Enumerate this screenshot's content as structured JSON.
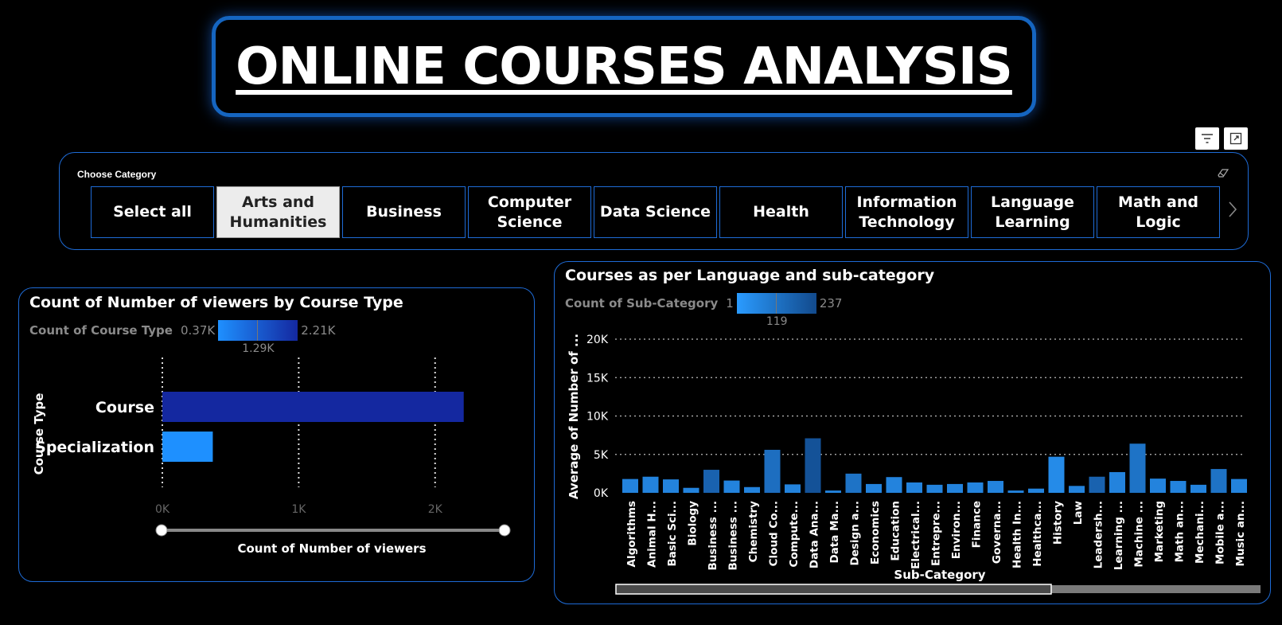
{
  "page": {
    "title": "ONLINE COURSES ANALYSIS"
  },
  "slicer": {
    "label": "Choose Category",
    "items": [
      {
        "label": "Select all",
        "selected": false
      },
      {
        "label": "Arts and Humanities",
        "selected": true
      },
      {
        "label": "Business",
        "selected": false
      },
      {
        "label": "Computer Science",
        "selected": false
      },
      {
        "label": "Data Science",
        "selected": false
      },
      {
        "label": "Health",
        "selected": false
      },
      {
        "label": "Information Technology",
        "selected": false
      },
      {
        "label": "Language Learning",
        "selected": false
      },
      {
        "label": "Math and Logic",
        "selected": false
      }
    ]
  },
  "icons": {
    "filter": "filter-icon",
    "focus": "focus-mode-icon",
    "eraser": "eraser-icon",
    "next": "chevron-right-icon"
  },
  "colors": {
    "accent": "#1e6bd6",
    "title_border": "#1565c0",
    "bar_dark": "#1428a0",
    "bar_light": "#1e90ff"
  },
  "chart_data": [
    {
      "type": "bar",
      "orientation": "horizontal",
      "title": "Count of Number of viewers by Course Type",
      "legend": {
        "name": "Count of Course Type",
        "min": "0.37K",
        "mid": "1.29K",
        "max": "2.21K"
      },
      "categories": [
        "Course",
        "Specialization"
      ],
      "values": [
        2210,
        370
      ],
      "xlabel": "Count of Number of viewers",
      "ylabel": "Course Type",
      "xticks": [
        "0K",
        "1K",
        "2K"
      ],
      "xlim": [
        0,
        2550
      ],
      "grid": true
    },
    {
      "type": "bar",
      "title": "Courses as per Language and sub-category",
      "legend": {
        "name": "Count of Sub-Category",
        "min": "1",
        "mid": "119",
        "max": "237"
      },
      "categories": [
        "Algorithms",
        "Animal H...",
        "Basic Sci...",
        "Biology",
        "Business ...",
        "Business ...",
        "Chemistry",
        "Cloud Co...",
        "Compute...",
        "Data Ana...",
        "Data Ma...",
        "Design a...",
        "Economics",
        "Education",
        "Electrical...",
        "Entrepre...",
        "Environ...",
        "Finance",
        "Governa...",
        "Health In...",
        "Healthca...",
        "History",
        "Law",
        "Leadersh...",
        "Learning ...",
        "Machine ...",
        "Marketing",
        "Math an...",
        "Mechani...",
        "Mobile a...",
        "Music an..."
      ],
      "values": [
        1800,
        2100,
        1750,
        650,
        3000,
        1600,
        750,
        5600,
        1100,
        7100,
        300,
        2500,
        1150,
        2050,
        1350,
        1050,
        1150,
        1350,
        1550,
        300,
        550,
        4700,
        900,
        2100,
        2700,
        6400,
        1850,
        1550,
        1050,
        3100,
        1800
      ],
      "color_levels": [
        0.3,
        0.3,
        0.3,
        0.3,
        0.7,
        0.3,
        0.3,
        0.55,
        0.3,
        0.9,
        0.3,
        0.5,
        0.3,
        0.3,
        0.3,
        0.3,
        0.3,
        0.3,
        0.3,
        0.3,
        0.3,
        0.2,
        0.3,
        0.7,
        0.3,
        0.5,
        0.3,
        0.3,
        0.3,
        0.5,
        0.3
      ],
      "xlabel": "Sub-Category",
      "ylabel": "Average of Number of ...",
      "yticks": [
        "0K",
        "5K",
        "10K",
        "15K",
        "20K"
      ],
      "ylim": [
        0,
        20000
      ],
      "grid": true
    }
  ]
}
